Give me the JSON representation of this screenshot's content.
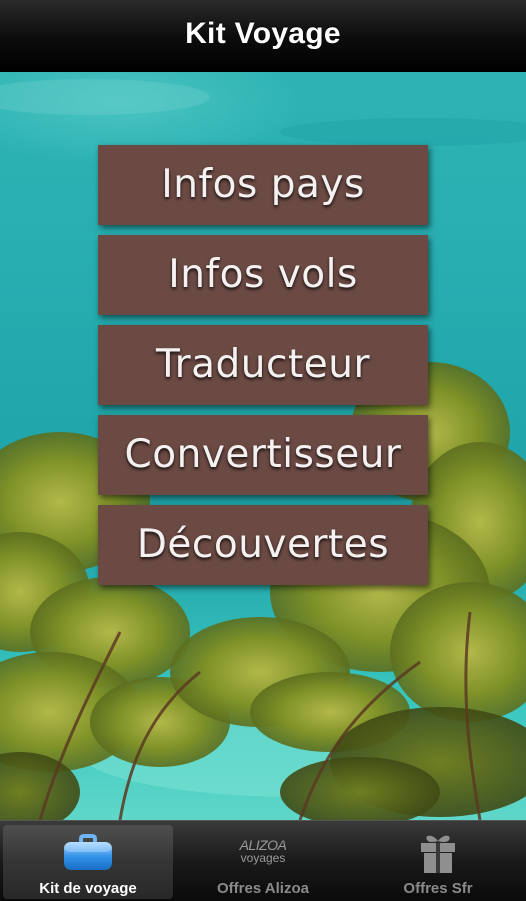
{
  "header": {
    "title": "Kit Voyage"
  },
  "menu": {
    "items": [
      {
        "label": "Infos pays"
      },
      {
        "label": "Infos vols"
      },
      {
        "label": "Traducteur"
      },
      {
        "label": "Convertisseur"
      },
      {
        "label": "Découvertes"
      }
    ]
  },
  "tabbar": {
    "tabs": [
      {
        "label": "Kit de voyage",
        "icon": "briefcase-icon",
        "active": true
      },
      {
        "label": "Offres Alizoa",
        "icon": "alizoa-logo",
        "logo_text_top": "ALIZOA",
        "logo_text_bottom": "voyages",
        "active": false
      },
      {
        "label": "Offres Sfr",
        "icon": "gift-icon",
        "active": false
      }
    ]
  },
  "colors": {
    "button_bg": "#6c4a44",
    "sea": "#22a9ad",
    "foliage": "#8a9a2a",
    "tab_active_text": "#ffffff",
    "tab_inactive_text": "#8a8a8a"
  }
}
